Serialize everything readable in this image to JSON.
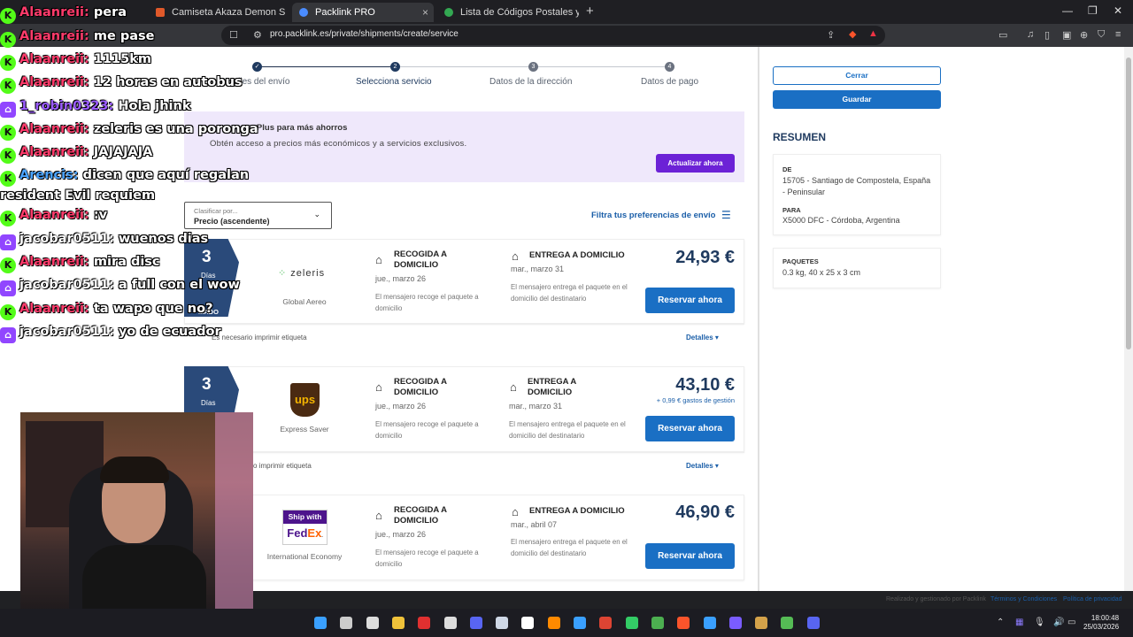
{
  "browser": {
    "tabs": [
      {
        "title": "Camiseta Akaza Demon Slayer, Kime",
        "favicon_color": "#e0592a"
      },
      {
        "title": "Packlink PRO",
        "favicon_color": "#4a8cff"
      },
      {
        "title": "Lista de Códigos Postales y ZIP de Cc",
        "favicon_color": "#33a852"
      }
    ],
    "url": "pro.packlink.es/private/shipments/create/service",
    "new_tab": "+",
    "close_glyph": "×"
  },
  "stepper": {
    "steps": [
      {
        "label": "Detalles del envío",
        "num": "✓"
      },
      {
        "label": "Selecciona servicio",
        "num": "2"
      },
      {
        "label": "Datos de la dirección",
        "num": "3"
      },
      {
        "label": "Datos de pago",
        "num": "4"
      }
    ]
  },
  "promo": {
    "title": "a Plus para más ahorros",
    "subtitle": "Obtén acceso a precios más económicos y a servicios exclusivos.",
    "button": "Actualizar ahora"
  },
  "sort": {
    "label": "Clasificar por...",
    "value": "Precio (ascendente)"
  },
  "filter": {
    "label": "Filtra tus preferencias de envío"
  },
  "services": [
    {
      "days": "3",
      "days_label": "Días",
      "extra": "MADO",
      "carrier_logo": "zeleris",
      "carrier_service": "Global Aereo",
      "pickup_title": "RECOGIDA A DOMICILIO",
      "pickup_date": "jue., marzo 26",
      "pickup_desc": "El mensajero recoge el paquete a domicilio",
      "delivery_title": "ENTREGA A DOMICILIO",
      "delivery_date": "mar., marzo 31",
      "delivery_desc": "El mensajero entrega el paquete en el domicilio del destinatario",
      "price": "24,93 €",
      "fee": "",
      "reserve": "Reservar ahora",
      "label_note": "Es necesario imprimir etiqueta",
      "details": "Detalles ▾"
    },
    {
      "days": "3",
      "days_label": "Días",
      "extra": "",
      "carrier_logo": "ups",
      "carrier_service": "Express Saver",
      "pickup_title": "RECOGIDA A DOMICILIO",
      "pickup_date": "jue., marzo 26",
      "pickup_desc": "El mensajero recoge el paquete a domicilio",
      "delivery_title": "ENTREGA A DOMICILIO",
      "delivery_date": "mar., marzo 31",
      "delivery_desc": "El mensajero entrega el paquete en el domicilio del destinatario",
      "price": "43,10 €",
      "fee": "+ 0,99 € gastos de gestión",
      "reserve": "Reservar ahora",
      "label_note": "o imprimir etiqueta",
      "details": "Detalles ▾"
    },
    {
      "days": "",
      "days_label": "",
      "extra": "",
      "carrier_logo": "Ship with FedEx",
      "carrier_service": "International Economy",
      "pickup_title": "RECOGIDA A DOMICILIO",
      "pickup_date": "jue., marzo 26",
      "pickup_desc": "El mensajero recoge el paquete a domicilio",
      "delivery_title": "ENTREGA A DOMICILIO",
      "delivery_date": "mar., abril 07",
      "delivery_desc": "El mensajero entrega el paquete en el domicilio del destinatario",
      "price": "46,90 €",
      "fee": "",
      "reserve": "Reservar ahora",
      "label_note": "",
      "details": ""
    }
  ],
  "summary": {
    "close": "Cerrar",
    "save": "Guardar",
    "title": "RESUMEN",
    "from_label": "DE",
    "from_value": "15705 - Santiago de Compostela, España - Peninsular",
    "to_label": "PARA",
    "to_value": "X5000 DFC - Córdoba, Argentina",
    "packages_label": "PAQUETES",
    "packages_value": "0.3 kg, 40 x 25 x 3 cm"
  },
  "footer": {
    "managed": "Realizado y gestionado por Packlink",
    "terms": "Términos y Condiciones",
    "privacy": "Política de privacidad"
  },
  "chat": [
    {
      "platform": "kick",
      "user": "Alaanreii:",
      "msg": "pera",
      "color": "#ff3b6b"
    },
    {
      "platform": "kick",
      "user": "Alaanreii:",
      "msg": "me pase",
      "color": "#ff3b6b"
    },
    {
      "platform": "kick",
      "user": "Alaanreii:",
      "msg": "1115km",
      "color": "#ff3b6b"
    },
    {
      "platform": "kick",
      "user": "Alaanreii:",
      "msg": "12 horas en autobus",
      "color": "#ff3b6b"
    },
    {
      "platform": "twitch",
      "user": "1_robin0323:",
      "msg": "Hola jhink",
      "color": "#9b5cff"
    },
    {
      "platform": "kick",
      "user": "Alaanreii:",
      "msg": "zeleris es una poronga",
      "color": "#ff3b6b"
    },
    {
      "platform": "kick",
      "user": "Alaanreii:",
      "msg": "JAJAJAJA",
      "color": "#ff3b6b"
    },
    {
      "platform": "kick",
      "user": "Arencis:",
      "msg": "dicen que aquí regalan",
      "color": "#4aa3ff"
    },
    {
      "platform": "none",
      "user": "",
      "msg": "resident Evil requiem",
      "color": "#ffffff"
    },
    {
      "platform": "kick",
      "user": "Alaanreii:",
      "msg": ":v",
      "color": "#ff3b6b"
    },
    {
      "platform": "twitch",
      "user": "jacobar0511:",
      "msg": "wuenos dias",
      "color": "#ffffff"
    },
    {
      "platform": "kick",
      "user": "Alaanreii:",
      "msg": "mira disc",
      "color": "#ff3b6b"
    },
    {
      "platform": "twitch",
      "user": "jacobar0511:",
      "msg": "a full con el wow",
      "color": "#ffffff"
    },
    {
      "platform": "kick",
      "user": "Alaanreii:",
      "msg": "ta wapo que no?",
      "color": "#ff3b6b"
    },
    {
      "platform": "twitch",
      "user": "jacobar0511:",
      "msg": "yo de ecuador",
      "color": "#ffffff"
    }
  ],
  "taskbar": {
    "time": "18:00:48",
    "date": "25/03/2026",
    "apps": [
      "#3aa0ff",
      "#cccccc",
      "#dddddd",
      "#f0c23a",
      "#e03030",
      "#dddddd",
      "#5865f2",
      "#cfd8e6",
      "#ffffff",
      "#ff8a00",
      "#3aa0ff",
      "#dd4433",
      "#33cc66",
      "#4caf50",
      "#fb542b",
      "#3aa0ff",
      "#7a5cff",
      "#d4a24a",
      "#55bb55",
      "#5865f2"
    ]
  }
}
